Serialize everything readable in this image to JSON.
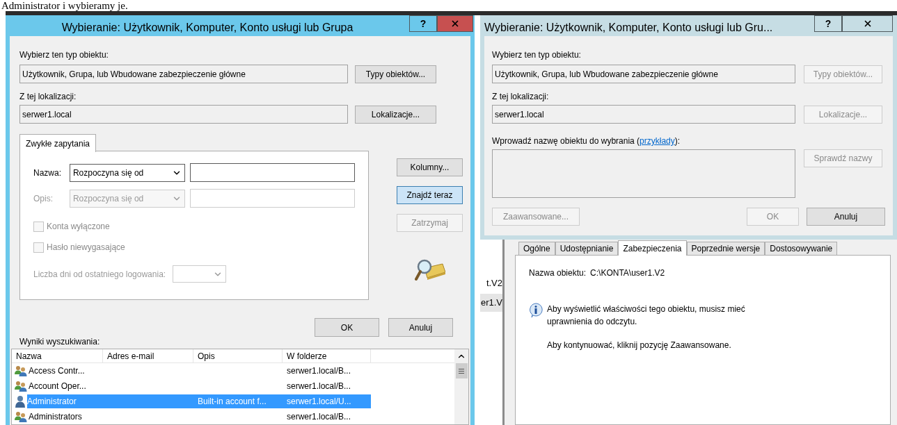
{
  "page_text": "Administrator i wybieramy je.",
  "left_dialog": {
    "title": "Wybieranie: Użytkownik, Komputer, Konto usługi lub Grupa",
    "active": true,
    "help_button": "?",
    "object_type": {
      "label": "Wybierz ten typ obiektu:",
      "value": "Użytkownik, Grupa, lub Wbudowane zabezpieczenie główne",
      "button": {
        "label": "Typy obiektów...",
        "disabled": false
      }
    },
    "location": {
      "label": "Z tej lokalizacji:",
      "value": "serwer1.local",
      "button": {
        "label": "Lokalizacje...",
        "disabled": false
      }
    },
    "tabs": [
      {
        "label": "Zwykłe zapytania",
        "selected": true
      }
    ],
    "query_rows": [
      {
        "label": "Nazwa:",
        "operator": "Rozpoczyna się od",
        "disabled": false
      },
      {
        "label": "Opis:",
        "operator": "Rozpoczyna się od",
        "disabled": true
      }
    ],
    "checkboxes": [
      {
        "label": "Konta wyłączone",
        "checked": false,
        "disabled": true
      },
      {
        "label": "Hasło niewygasające",
        "checked": false,
        "disabled": true
      }
    ],
    "days": {
      "label": "Liczba dni od ostatniego logowania:",
      "disabled": true
    },
    "side_buttons": [
      {
        "label": "Kolumny...",
        "disabled": false,
        "default": false
      },
      {
        "label": "Znajdź teraz",
        "disabled": false,
        "default": true
      },
      {
        "label": "Zatrzymaj",
        "disabled": true,
        "default": false
      }
    ],
    "buttons": [
      {
        "label": "OK",
        "disabled": false
      },
      {
        "label": "Anuluj",
        "disabled": false
      }
    ],
    "results": {
      "label": "Wyniki wyszukiwania:",
      "columns": [
        "Nazwa",
        "Adres e-mail",
        "Opis",
        "W folderze"
      ],
      "rows": [
        {
          "kind": "group",
          "name": "Access Contr...",
          "folder": "serwer1.local/B...",
          "selected": false
        },
        {
          "kind": "group",
          "name": "Account Oper...",
          "folder": "serwer1.local/B...",
          "selected": false
        },
        {
          "kind": "user",
          "name": "Administrator",
          "description": "Built-in account f...",
          "folder": "serwer1.local/U...",
          "selected": true
        },
        {
          "kind": "group",
          "name": "Administrators",
          "folder": "serwer1.local/B...",
          "selected": false
        }
      ]
    }
  },
  "right_dialog": {
    "title": "Wybieranie: Użytkownik, Komputer, Konto usługi lub Gru...",
    "active": false,
    "help_button": "?",
    "object_type": {
      "label": "Wybierz ten typ obiektu:",
      "value": "Użytkownik, Grupa, lub Wbudowane zabezpieczenie główne",
      "button": {
        "label": "Typy obiektów...",
        "disabled": true
      }
    },
    "location": {
      "label": "Z tej lokalizacji:",
      "value": "serwer1.local",
      "button": {
        "label": "Lokalizacje...",
        "disabled": true
      }
    },
    "names": {
      "label_before": "Wprowadź nazwę obiektu do wybrania (",
      "link": "przykłady",
      "label_after": "):",
      "disabled": true
    },
    "check_button": {
      "label": "Sprawdź nazwy",
      "disabled": true
    },
    "buttons": [
      {
        "label": "Zaawansowane...",
        "disabled": true
      },
      {
        "label": "OK",
        "disabled": true
      },
      {
        "label": "Anuluj",
        "disabled": false
      }
    ]
  },
  "background": {
    "list_items": [
      {
        "text": "t.V2",
        "selected": false
      },
      {
        "text": "er1.V",
        "selected": true
      }
    ],
    "properties": {
      "tabs": [
        {
          "label": "Ogólne",
          "selected": false
        },
        {
          "label": "Udostępnianie",
          "selected": false
        },
        {
          "label": "Zabezpieczenia",
          "selected": true
        },
        {
          "label": "Poprzednie wersje",
          "selected": false
        },
        {
          "label": "Dostosowywanie",
          "selected": false
        }
      ],
      "object_name_label": "Nazwa obiektu:",
      "object_name": "C:\\KONTA\\user1.V2",
      "messages": [
        "Aby wyświetlić właściwości tego obiektu, musisz mieć uprawnienia do odczytu.",
        "Aby kontynuować, kliknij pozycję Zaawansowane."
      ]
    }
  }
}
